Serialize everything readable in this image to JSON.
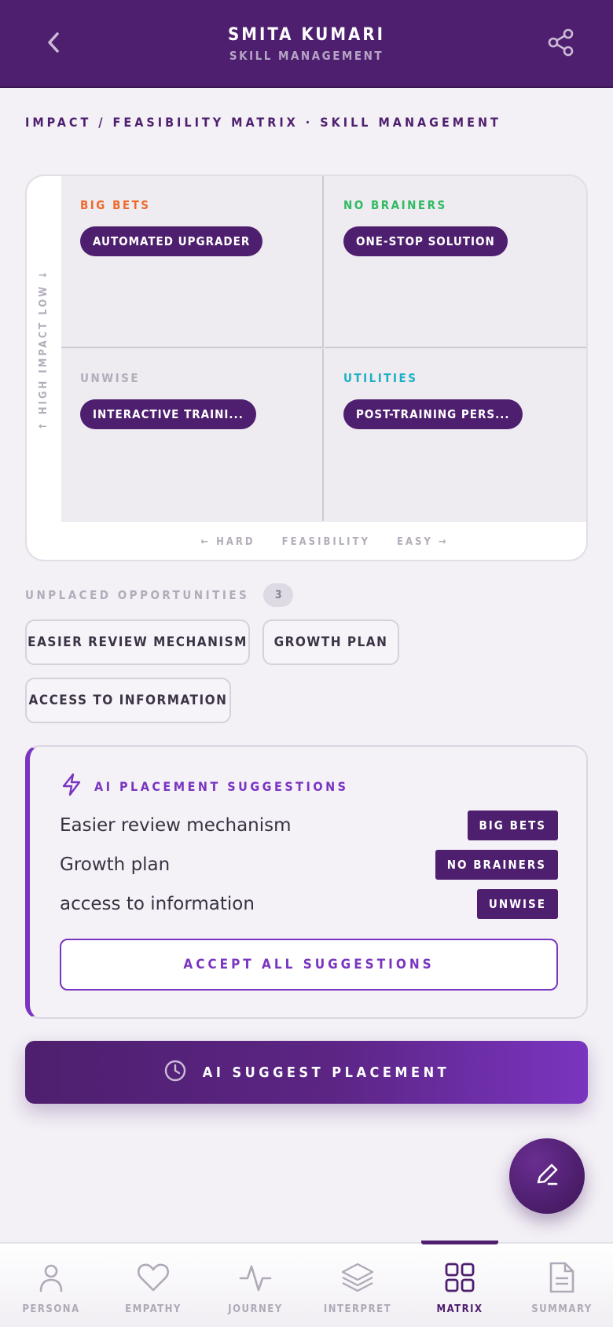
{
  "header": {
    "title": "SMITA KUMARI",
    "subtitle": "SKILL MANAGEMENT",
    "back_icon": "chevron-left-icon",
    "share_icon": "share-icon"
  },
  "section_title": "IMPACT / FEASIBILITY MATRIX · SKILL MANAGEMENT",
  "matrix": {
    "y_axis_label": "↑ HIGH IMPACT LOW ↓",
    "x_axis": {
      "hard": "← HARD",
      "label": "FEASIBILITY",
      "easy": "EASY →"
    },
    "quadrants": [
      {
        "label": "BIG BETS",
        "color": "#ee6a2c",
        "chip": "AUTOMATED UPGRADER"
      },
      {
        "label": "NO BRAINERS",
        "color": "#2fbb62",
        "chip": "ONE-STOP SOLUTION"
      },
      {
        "label": "UNWISE",
        "color": "#b3acba",
        "chip": "INTERACTIVE TRAINI..."
      },
      {
        "label": "UTILITIES",
        "color": "#1ab0c4",
        "chip": "POST-TRAINING PERS..."
      }
    ]
  },
  "unplaced": {
    "label": "UNPLACED OPPORTUNITIES",
    "count": "3",
    "items": [
      "EASIER REVIEW MECHANISM",
      "GROWTH PLAN",
      "ACCESS TO INFORMATION"
    ]
  },
  "ai_suggestions": {
    "title": "AI PLACEMENT SUGGESTIONS",
    "icon": "lightning-icon",
    "rows": [
      {
        "name": "Easier review mechanism",
        "tag": "BIG BETS"
      },
      {
        "name": "Growth plan",
        "tag": "NO BRAINERS"
      },
      {
        "name": "access to information",
        "tag": "UNWISE"
      }
    ],
    "accept_label": "ACCEPT ALL SUGGESTIONS"
  },
  "cta": {
    "label": "AI SUGGEST PLACEMENT",
    "icon": "clock-icon"
  },
  "fab": {
    "icon": "pencil-icon"
  },
  "nav": {
    "items": [
      {
        "label": "PERSONA",
        "icon": "person-icon"
      },
      {
        "label": "EMPATHY",
        "icon": "heart-icon"
      },
      {
        "label": "JOURNEY",
        "icon": "pulse-icon"
      },
      {
        "label": "INTERPRET",
        "icon": "layers-icon"
      },
      {
        "label": "MATRIX",
        "icon": "grid-icon"
      },
      {
        "label": "SUMMARY",
        "icon": "document-icon"
      }
    ],
    "active": "MATRIX"
  },
  "colors": {
    "brand": "#4e1f6e",
    "accent": "#7a35c0",
    "background": "#f3f0f6"
  }
}
